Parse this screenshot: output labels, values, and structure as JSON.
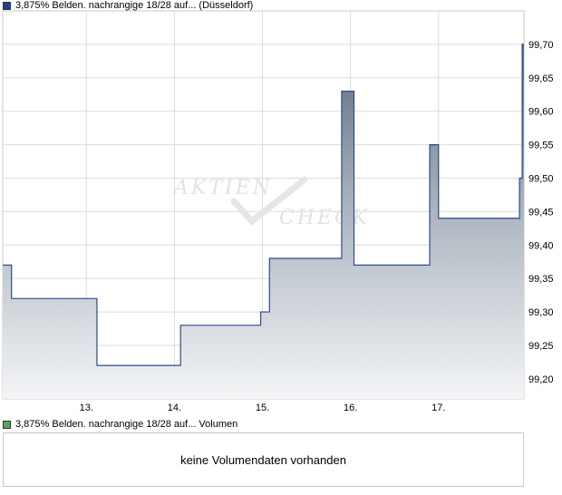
{
  "price_legend": {
    "label": "3,875% Belden. nachrangige 18/28 auf... (Düsseldorf)",
    "color": "#1f3f8f"
  },
  "volume_legend": {
    "label": "3,875% Belden. nachrangige 18/28 auf... Volumen",
    "color": "#5aa55a"
  },
  "volume_message": "keine Volumendaten vorhanden",
  "watermark": {
    "line1": "AKTIEN",
    "line2": "CHECK"
  },
  "chart_data": {
    "type": "area",
    "title": "3,875% Belden. nachrangige 18/28 auf... (Düsseldorf)",
    "x_tick_labels": [
      "13.",
      "14.",
      "15.",
      "16.",
      "17."
    ],
    "y_tick_labels": [
      "99,20",
      "99,25",
      "99,30",
      "99,35",
      "99,40",
      "99,45",
      "99,50",
      "99,55",
      "99,60",
      "99,65",
      "99,70"
    ],
    "ylim": [
      99.17,
      99.75
    ],
    "xlim": [
      12.05,
      17.97
    ],
    "grid": true,
    "line_color": "#2a4b8d",
    "x": [
      12.05,
      12.15,
      12.15,
      13.12,
      13.12,
      14.07,
      14.07,
      14.98,
      14.98,
      15.08,
      15.08,
      15.9,
      15.9,
      16.04,
      16.04,
      16.9,
      16.9,
      17.0,
      17.0,
      17.92,
      17.92,
      17.95,
      17.95,
      17.97
    ],
    "y": [
      99.37,
      99.37,
      99.32,
      99.32,
      99.22,
      99.22,
      99.28,
      99.28,
      99.3,
      99.3,
      99.38,
      99.38,
      99.63,
      99.63,
      99.37,
      99.37,
      99.55,
      99.55,
      99.44,
      99.44,
      99.5,
      99.5,
      99.7,
      99.7
    ]
  }
}
